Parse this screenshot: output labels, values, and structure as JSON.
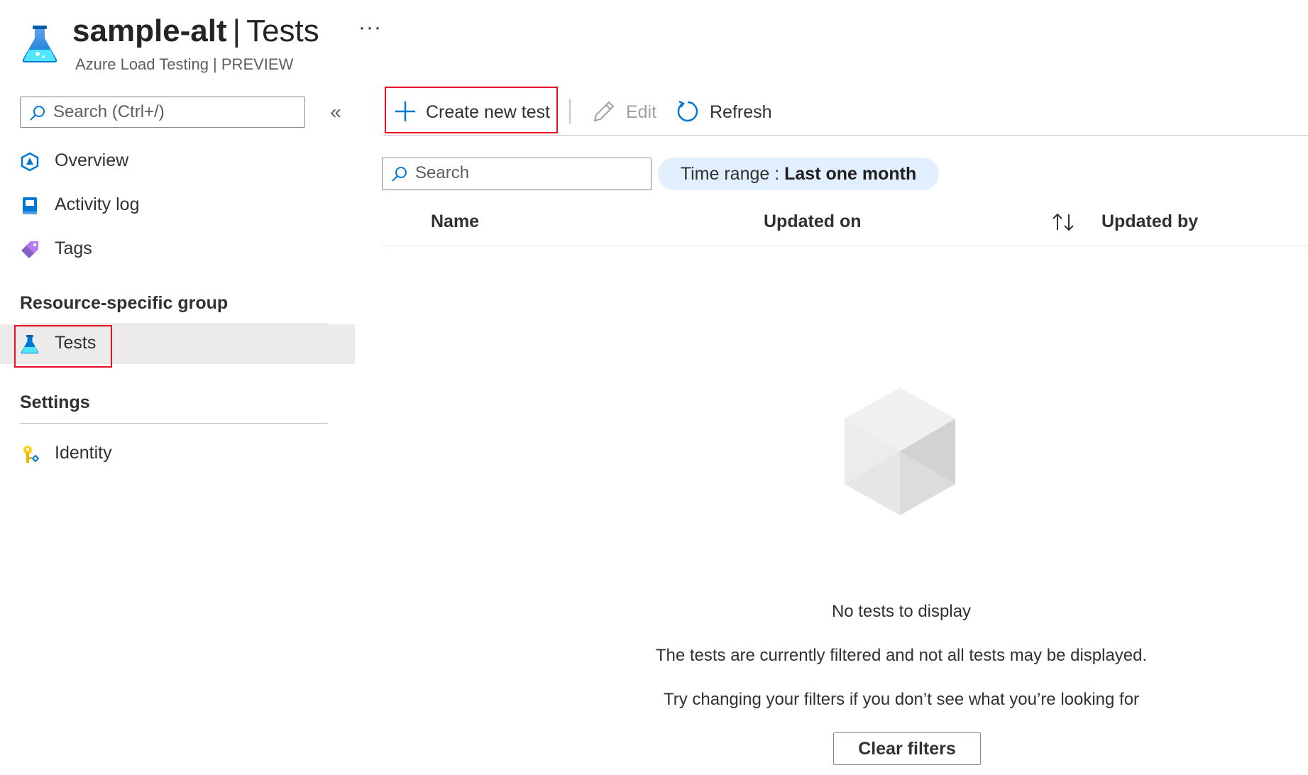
{
  "header": {
    "resource_name": "sample-alt",
    "separator": "|",
    "page_name": "Tests",
    "more_label": "···",
    "subtitle": "Azure Load Testing | PREVIEW"
  },
  "sidebar": {
    "search_placeholder": "Search (Ctrl+/)",
    "collapse_label": "«",
    "items": [
      {
        "label": "Overview",
        "icon": "overview-icon"
      },
      {
        "label": "Activity log",
        "icon": "activity-log-icon"
      },
      {
        "label": "Tags",
        "icon": "tag-icon"
      }
    ],
    "groups": [
      {
        "title": "Resource-specific group",
        "items": [
          {
            "label": "Tests",
            "icon": "flask-icon",
            "selected": true
          }
        ]
      },
      {
        "title": "Settings",
        "items": [
          {
            "label": "Identity",
            "icon": "identity-key-icon"
          }
        ]
      }
    ]
  },
  "toolbar": {
    "create_label": "Create new test",
    "edit_label": "Edit",
    "refresh_label": "Refresh"
  },
  "filters": {
    "search_placeholder": "Search",
    "time_range_label": "Time range : ",
    "time_range_value": "Last one month"
  },
  "table": {
    "columns": [
      "Name",
      "Updated on",
      "Updated by"
    ]
  },
  "empty_state": {
    "title": "No tests to display",
    "line1": "The tests are currently filtered and not all tests may be displayed.",
    "line2": "Try changing your filters if you don’t see what you’re looking for",
    "clear_label": "Clear filters"
  },
  "colors": {
    "accent_blue": "#0078d4",
    "highlight_red": "#e81123",
    "pill_bg": "#e1efff",
    "selected_bg": "#edebe9"
  }
}
